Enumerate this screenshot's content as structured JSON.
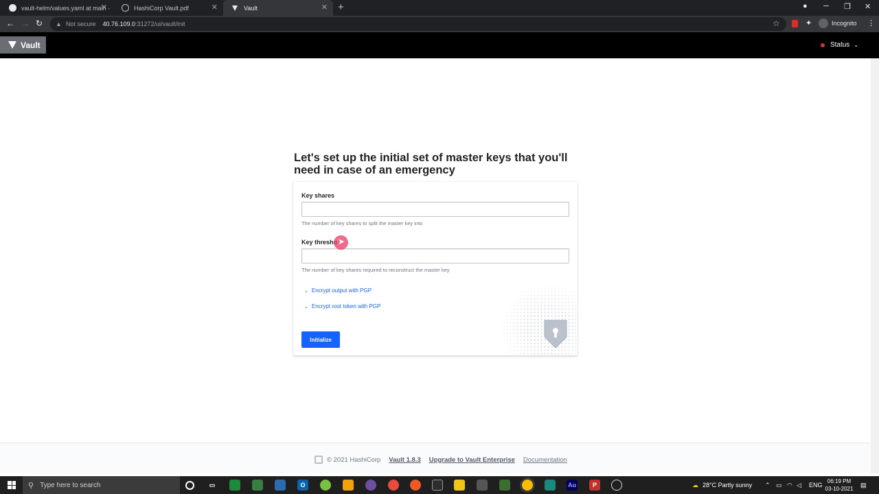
{
  "browser": {
    "tabs": [
      {
        "title": "vault-helm/values.yaml at main ·",
        "icon": "github-icon"
      },
      {
        "title": "HashiCorp Vault.pdf",
        "icon": "globe-icon"
      },
      {
        "title": "Vault",
        "icon": "vault-icon",
        "active": true
      }
    ],
    "security_label": "Not secure",
    "url_host": "40.76.109.0",
    "url_path": ":31272/ui/vault/init",
    "profile_label": "Incognito"
  },
  "header": {
    "logo_text": "Vault",
    "status_label": "Status",
    "status_color": "#c73445"
  },
  "init": {
    "heading": "Let's set up the initial set of master keys that you'll need in case of an emergency",
    "key_shares_label": "Key shares",
    "key_shares_value": "",
    "key_shares_help": "The number of key shares to split the master key into",
    "key_threshold_label": "Key thresho",
    "key_threshold_value": "",
    "key_threshold_help": "The number of key shares required to reconstruct the master key",
    "encrypt_output_label": "Encrypt output with PGP",
    "encrypt_root_label": "Encrypt root token with PGP",
    "initialize_label": "Initialize",
    "accent_color": "#1563ff"
  },
  "footer": {
    "copyright": "© 2021 HashiCorp",
    "version_link": "Vault 1.8.3",
    "upgrade_link": "Upgrade to Vault Enterprise",
    "docs_link": "Documentation"
  },
  "taskbar": {
    "search_placeholder": "Type here to search",
    "weather": "28°C  Partly sunny",
    "language": "ENG",
    "time": "06:19 PM",
    "date": "03-10-2021"
  }
}
